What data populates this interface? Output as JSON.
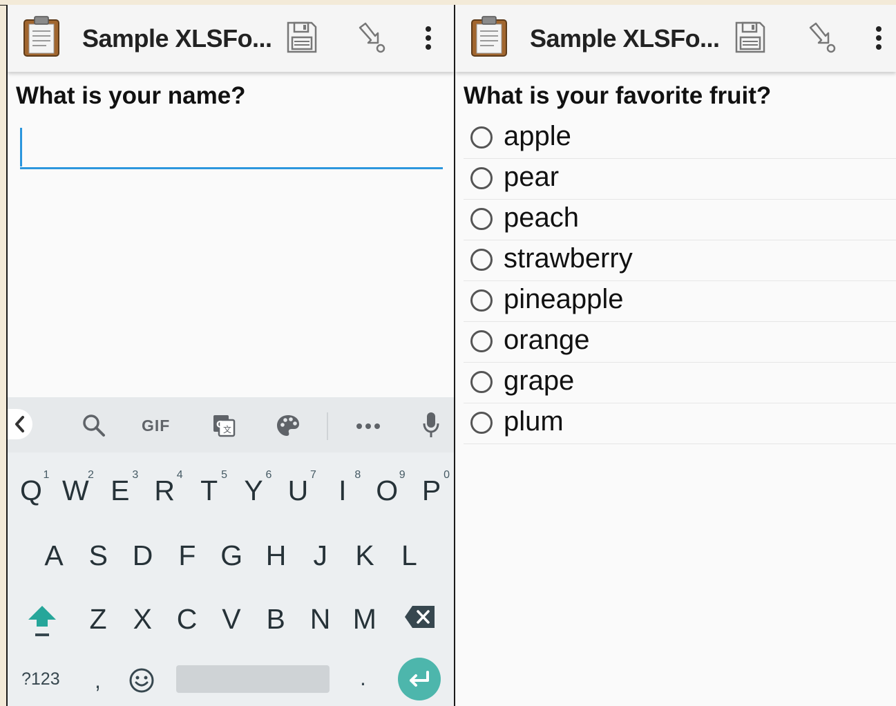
{
  "left_screen": {
    "appbar": {
      "title": "Sample XLSFo..."
    },
    "question": "What is your name?",
    "name_input": {
      "value": ""
    },
    "keyboard": {
      "toolbar": {
        "gif_label": "GIF"
      },
      "row1": [
        {
          "key": "Q",
          "hint": "1"
        },
        {
          "key": "W",
          "hint": "2"
        },
        {
          "key": "E",
          "hint": "3"
        },
        {
          "key": "R",
          "hint": "4"
        },
        {
          "key": "T",
          "hint": "5"
        },
        {
          "key": "Y",
          "hint": "6"
        },
        {
          "key": "U",
          "hint": "7"
        },
        {
          "key": "I",
          "hint": "8"
        },
        {
          "key": "O",
          "hint": "9"
        },
        {
          "key": "P",
          "hint": "0"
        }
      ],
      "row2": [
        "A",
        "S",
        "D",
        "F",
        "G",
        "H",
        "J",
        "K",
        "L"
      ],
      "row3": [
        "Z",
        "X",
        "C",
        "V",
        "B",
        "N",
        "M"
      ],
      "bottom": {
        "symbols_label": "?123",
        "comma": ",",
        "period": "."
      }
    }
  },
  "right_screen": {
    "appbar": {
      "title": "Sample XLSFo..."
    },
    "question": "What is your favorite fruit?",
    "options": [
      "apple",
      "pear",
      "peach",
      "strawberry",
      "pineapple",
      "orange",
      "grape",
      "plum"
    ]
  },
  "colors": {
    "accent": "#2b96dd",
    "enter_key": "#4db6ac"
  }
}
